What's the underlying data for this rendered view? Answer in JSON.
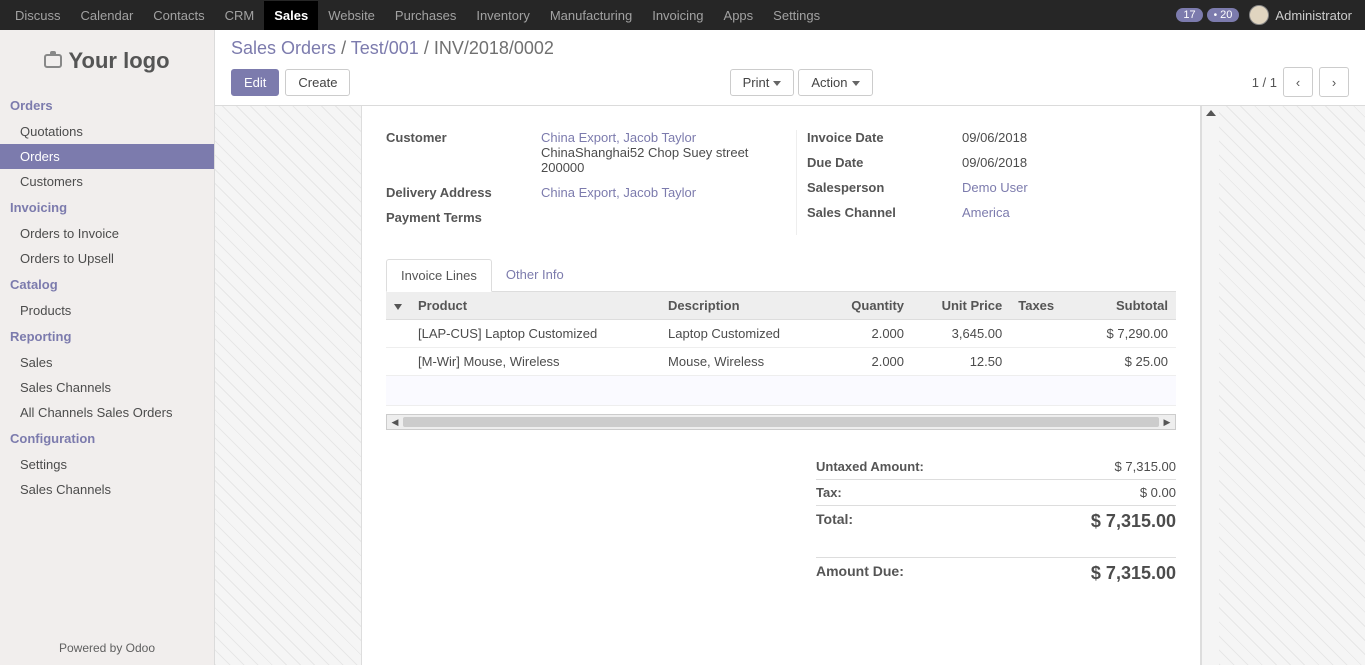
{
  "topnav": {
    "items": [
      "Discuss",
      "Calendar",
      "Contacts",
      "CRM",
      "Sales",
      "Website",
      "Purchases",
      "Inventory",
      "Manufacturing",
      "Invoicing",
      "Apps",
      "Settings"
    ],
    "active_index": 4,
    "badge1": "17",
    "badge2": "20",
    "user": "Administrator"
  },
  "logo": "Your logo",
  "sidebar": {
    "sections": [
      {
        "title": "Orders",
        "items": [
          "Quotations",
          "Orders",
          "Customers"
        ],
        "active": "Orders"
      },
      {
        "title": "Invoicing",
        "items": [
          "Orders to Invoice",
          "Orders to Upsell"
        ]
      },
      {
        "title": "Catalog",
        "items": [
          "Products"
        ]
      },
      {
        "title": "Reporting",
        "items": [
          "Sales",
          "Sales Channels",
          "All Channels Sales Orders"
        ]
      },
      {
        "title": "Configuration",
        "items": [
          "Settings",
          "Sales Channels"
        ]
      }
    ],
    "footer": "Powered by Odoo"
  },
  "breadcrumb": {
    "a": "Sales Orders",
    "b": "Test/001",
    "c": "INV/2018/0002"
  },
  "buttons": {
    "edit": "Edit",
    "create": "Create",
    "print": "Print",
    "action": "Action"
  },
  "pager": {
    "text": "1 / 1"
  },
  "record": {
    "customer_label": "Customer",
    "customer_link": "China Export, Jacob Taylor",
    "customer_address": "ChinaShanghai52 Chop Suey street 200000",
    "delivery_label": "Delivery Address",
    "delivery_link": "China Export, Jacob Taylor",
    "payment_terms_label": "Payment Terms",
    "invoice_date_label": "Invoice Date",
    "invoice_date": "09/06/2018",
    "due_date_label": "Due Date",
    "due_date": "09/06/2018",
    "salesperson_label": "Salesperson",
    "salesperson": "Demo User",
    "sales_channel_label": "Sales Channel",
    "sales_channel": "America"
  },
  "tabs": {
    "lines": "Invoice Lines",
    "other": "Other Info"
  },
  "table": {
    "headers": {
      "product": "Product",
      "desc": "Description",
      "qty": "Quantity",
      "price": "Unit Price",
      "taxes": "Taxes",
      "subtotal": "Subtotal"
    },
    "rows": [
      {
        "product": "[LAP-CUS] Laptop Customized",
        "desc": "Laptop Customized",
        "qty": "2.000",
        "price": "3,645.00",
        "subtotal": "$ 7,290.00"
      },
      {
        "product": "[M-Wir] Mouse, Wireless",
        "desc": "Mouse, Wireless",
        "qty": "2.000",
        "price": "12.50",
        "subtotal": "$ 25.00"
      }
    ]
  },
  "totals": {
    "untaxed_label": "Untaxed Amount:",
    "untaxed": "$ 7,315.00",
    "tax_label": "Tax:",
    "tax": "$ 0.00",
    "total_label": "Total:",
    "total": "$ 7,315.00",
    "due_label": "Amount Due:",
    "due": "$ 7,315.00"
  }
}
